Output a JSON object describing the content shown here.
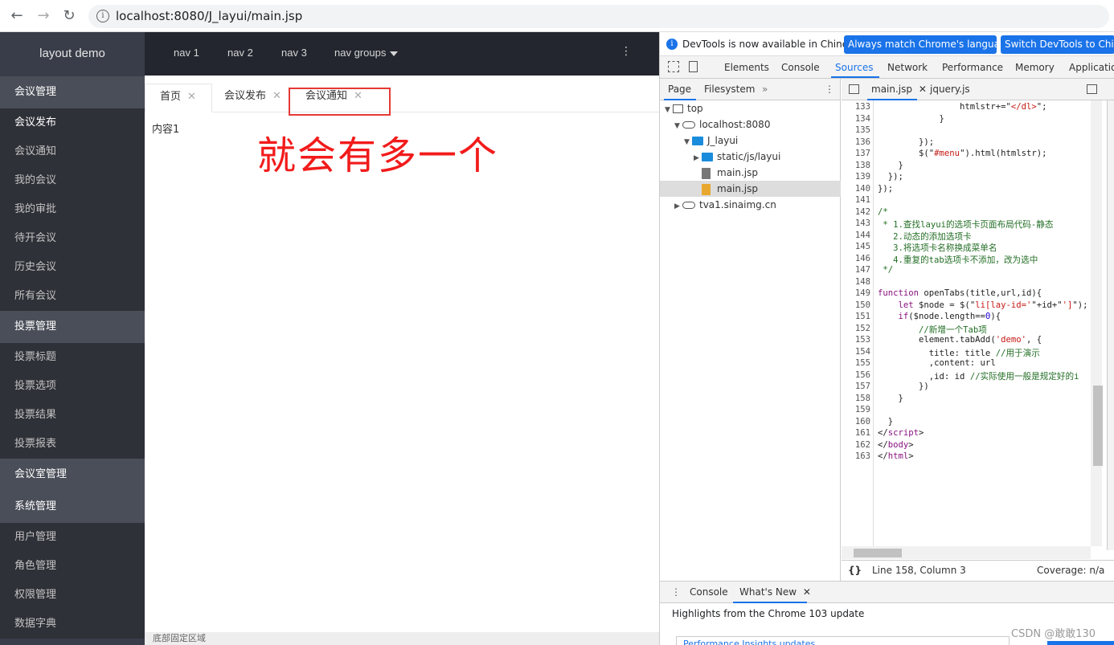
{
  "browser": {
    "url": "localhost:8080/J_layui/main.jsp",
    "back": "←",
    "forward": "→",
    "reload": "↻",
    "info": "i"
  },
  "app": {
    "logo": "layout demo",
    "topnav": [
      "nav 1",
      "nav 2",
      "nav 3",
      "nav groups"
    ],
    "menu": [
      {
        "type": "grp",
        "label": "会议管理"
      },
      {
        "type": "item",
        "label": "会议发布",
        "active": true
      },
      {
        "type": "item",
        "label": "会议通知"
      },
      {
        "type": "item",
        "label": "我的会议"
      },
      {
        "type": "item",
        "label": "我的审批"
      },
      {
        "type": "item",
        "label": "待开会议"
      },
      {
        "type": "item",
        "label": "历史会议"
      },
      {
        "type": "item",
        "label": "所有会议"
      },
      {
        "type": "grp",
        "label": "投票管理"
      },
      {
        "type": "item",
        "label": "投票标题"
      },
      {
        "type": "item",
        "label": "投票选项"
      },
      {
        "type": "item",
        "label": "投票结果"
      },
      {
        "type": "item",
        "label": "投票报表"
      },
      {
        "type": "grp",
        "label": "会议室管理"
      },
      {
        "type": "grp",
        "label": "系统管理"
      },
      {
        "type": "item",
        "label": "用户管理"
      },
      {
        "type": "item",
        "label": "角色管理"
      },
      {
        "type": "item",
        "label": "权限管理"
      },
      {
        "type": "item",
        "label": "数据字典"
      }
    ],
    "tabs": [
      {
        "label": "首页",
        "close": "✕"
      },
      {
        "label": "会议发布",
        "close": "✕"
      },
      {
        "label": "会议通知",
        "close": "✕"
      }
    ],
    "content": "内容1",
    "annotation": "就会有多一个",
    "footer": "底部固定区域"
  },
  "devtools": {
    "info_msg": "DevTools is now available in Chinese!",
    "btn_always": "Always match Chrome's language",
    "btn_switch": "Switch DevTools to Chinese",
    "tabs": [
      "Elements",
      "Console",
      "Sources",
      "Network",
      "Performance",
      "Memory",
      "Application"
    ],
    "selected_tab": "Sources",
    "left_tabs": [
      "Page",
      "Filesystem"
    ],
    "more": "»",
    "tree": [
      {
        "label": "top",
        "indent": 0,
        "icon": "frame",
        "tri": "▼"
      },
      {
        "label": "localhost:8080",
        "indent": 1,
        "icon": "cloud",
        "tri": "▼"
      },
      {
        "label": "J_layui",
        "indent": 2,
        "icon": "folder",
        "tri": "▼"
      },
      {
        "label": "static/js/layui",
        "indent": 3,
        "icon": "folder",
        "tri": "▶"
      },
      {
        "label": "main.jsp",
        "indent": 3,
        "icon": "file",
        "tri": ""
      },
      {
        "label": "main.jsp",
        "indent": 3,
        "icon": "filejs",
        "tri": "",
        "selected": true
      },
      {
        "label": "tva1.sinaimg.cn",
        "indent": 1,
        "icon": "cloud",
        "tri": "▶"
      }
    ],
    "file_tabs": [
      "main.jsp",
      "jquery.js"
    ],
    "code_lines": [
      {
        "n": "133",
        "html": "                htmlstr+=\"<span class='str'>&lt;/dl&gt;</span>\";"
      },
      {
        "n": "134",
        "html": "            }"
      },
      {
        "n": "135",
        "html": ""
      },
      {
        "n": "136",
        "html": "        });"
      },
      {
        "n": "137",
        "html": "        $(\"<span class='str'>#menu</span>\").html(htmlstr);"
      },
      {
        "n": "138",
        "html": "    }"
      },
      {
        "n": "139",
        "html": "  });"
      },
      {
        "n": "140",
        "html": "});"
      },
      {
        "n": "141",
        "html": ""
      },
      {
        "n": "142",
        "html": "<span class='cm'>/*</span>"
      },
      {
        "n": "143",
        "html": "<span class='cm'> * 1.查找layui的选项卡页面布局代码-静态</span>"
      },
      {
        "n": "144",
        "html": "<span class='cm'>   2.动态的添加选项卡</span>"
      },
      {
        "n": "145",
        "html": "<span class='cm'>   3.将选项卡名称换成菜单名</span>"
      },
      {
        "n": "146",
        "html": "<span class='cm'>   4.重复的tab选项卡不添加，改为选中</span>"
      },
      {
        "n": "147",
        "html": "<span class='cm'> */</span>"
      },
      {
        "n": "148",
        "html": ""
      },
      {
        "n": "149",
        "html": "<span class='kw'>function</span> openTabs(title,url,id){"
      },
      {
        "n": "150",
        "html": "    <span class='kw'>let</span> $node = $(\"<span class='str'>li[lay-id='</span>\"+id+\"<span class='str'>']</span>\");"
      },
      {
        "n": "151",
        "html": "    <span class='kw'>if</span>($node.length==<span class='num'>0</span>){"
      },
      {
        "n": "152",
        "html": "        <span class='cm'>//新增一个Tab项</span>"
      },
      {
        "n": "153",
        "html": "        element.tabAdd(<span class='str'>'demo'</span>, {"
      },
      {
        "n": "154",
        "html": "          title: title <span class='cm'>//用于演示</span>"
      },
      {
        "n": "155",
        "html": "          ,content: url"
      },
      {
        "n": "156",
        "html": "          ,id: id <span class='cm'>//实际使用一般是规定好的i</span>"
      },
      {
        "n": "157",
        "html": "        })"
      },
      {
        "n": "158",
        "html": "    }"
      },
      {
        "n": "159",
        "html": ""
      },
      {
        "n": "160",
        "html": "  }"
      },
      {
        "n": "161",
        "html": "&lt;/<span class='tag'>script</span>&gt;"
      },
      {
        "n": "162",
        "html": "&lt;/<span class='tag'>body</span>&gt;"
      },
      {
        "n": "163",
        "html": "&lt;/<span class='tag'>html</span>&gt;"
      }
    ],
    "status": "Line 158, Column 3",
    "coverage": "Coverage: n/a",
    "braces": "{}",
    "drawer_tabs": [
      "Console",
      "What's New"
    ],
    "highlights": "Highlights from the Chrome 103 update",
    "card": "Performance Insights updates"
  },
  "watermark": "CSDN @敢敢130"
}
